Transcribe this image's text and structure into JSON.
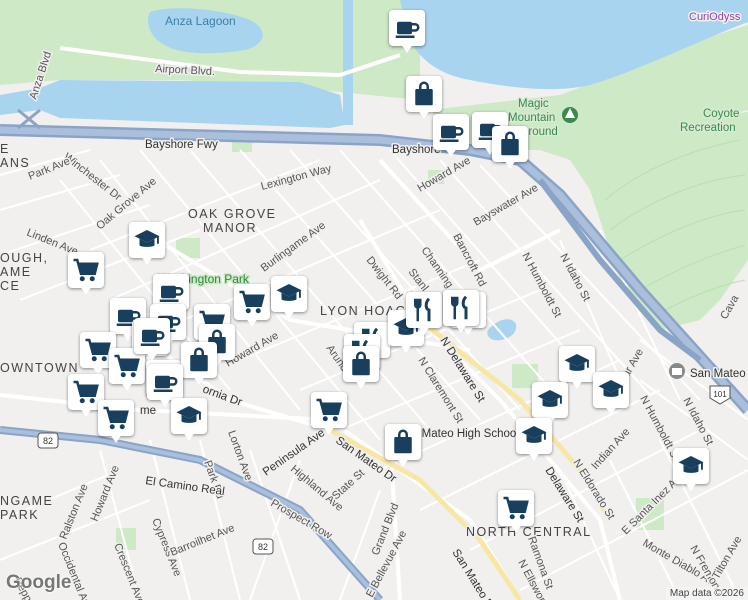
{
  "map": {
    "labels": {
      "anza_lagoon": "Anza Lagoon",
      "airport_blvd": "Airport Blvd.",
      "anza_blvd": "Anza Blvd",
      "bayshore_fwy_1": "Bayshore Fwy",
      "bayshore_fwy_2": "Bayshore",
      "magic_mountain": "Magic Mountain Playground",
      "magic_mountain_l1": "Magic",
      "magic_mountain_l2": "Mountain",
      "magic_mountain_l3": "ground",
      "coyote_point": "Coyote Recreation",
      "coyote_l1": "Coyote",
      "coyote_l2": "Recreation",
      "curiodyssey": "CuriOdyss",
      "oak_grove_manor_1": "OAK GROVE",
      "oak_grove_manor_2": "MANOR",
      "lyon_hoag": "LYON HOAG",
      "washington_park": "Washington Park",
      "downtown": "OWNTOWN",
      "north_central": "NORTH CENTRAL",
      "ngame_park_1": "NGAME",
      "ngame_park_2": "PARK",
      "ough_ame": "OUGH,",
      "ame": "AME",
      "ce": "CE",
      "ans": "ANS",
      "e_top": "E",
      "san_mateo_high": "San Mateo High School",
      "san_mateo_hq": "San Mateo",
      "winchester_dr": "Winchester Dr",
      "park_ave": "Park Ave",
      "oak_grove_ave": "Oak Grove Ave",
      "linden_ave": "Linden Ave",
      "lexington_way": "Lexington Way",
      "burlingame_ave": "Burlingame Ave",
      "howard_ave_top": "Howard Ave",
      "howard_ave_mid": "Howard Ave",
      "howard_ave_low": "Howard Ave",
      "bayswater_ave": "Bayswater Ave",
      "dwight_rd": "Dwight Rd",
      "stanley": "Stanl",
      "channing": "Channing",
      "bancroft_rd": "Bancroft Rd",
      "n_idaho_st": "N Idaho St",
      "n_humboldt_st": "N Humboldt St",
      "n_delaware_st": "N Delaware St",
      "n_delaware_st_2": "Delaware St",
      "n_claremont_st": "N Claremont St",
      "arundel": "Arund",
      "california_dr": "ornia Dr",
      "peninsula_ave": "Peninsula Ave",
      "san_mateo_dr": "San Mateo Dr",
      "san_mateo_dr_2": "San Mateo D",
      "lorton_ave": "Lorton Ave",
      "park_rd": "Park Rd",
      "highland_ave": "Highland Ave",
      "state_st": "State St",
      "prospect_row": "Prospect Row",
      "el_camino_real": "El Camino Real",
      "ralston_ave": "Ralston Ave",
      "howard_ave_sw": "Howard Ave",
      "occidental_ave": "Occidental Ave",
      "crescent_ave": "Crescent Ave",
      "cypress_ave": "Cypress Ave",
      "barroilhet_ave": "Barroilhet Ave",
      "grand_blvd": "Grand Blvd",
      "e_bellevue_ave": "E Bellevue Ave",
      "ramona_st": "Ramona St",
      "n_ellsworth": "N Ellswort",
      "n_eldorado_st": "N Eldorado St",
      "indian_ave": "Indian Ave",
      "e_santa_inez_ave": "E Santa Inez Ave",
      "monte_diablo_ave": "Monte Diablo Ave",
      "n_fremont": "N Fremon",
      "tilton_ave": "Tilton Ave",
      "cava": "Cava",
      "n_idaho_st_2": "N Idaho St",
      "n_humboldt_st_2": "N Humboldt St",
      "poplar_ave": "ar Ave",
      "peppe": "Peppe",
      "route_82_a": "82",
      "route_82_b": "82",
      "route_101": "101",
      "me_label": "me"
    },
    "attribution": "Map data ©2026",
    "google_logo": "Google",
    "colors": {
      "background": "#f1f0ee",
      "water": "#a8d4f0",
      "park": "#cde9c6",
      "highway": "#8aa4c8",
      "marker_icon": "#18405e"
    }
  },
  "markers": [
    {
      "type": "coffee-icon"
    },
    {
      "type": "shopping-bag-icon"
    },
    {
      "type": "coffee-icon"
    },
    {
      "type": "coffee-icon"
    },
    {
      "type": "shopping-bag-icon"
    },
    {
      "type": "school-icon"
    },
    {
      "type": "grocery-cart-icon"
    },
    {
      "type": "coffee-icon"
    },
    {
      "type": "grocery-cart-icon"
    },
    {
      "type": "school-icon"
    },
    {
      "type": "coffee-icon"
    },
    {
      "type": "coffee-icon"
    },
    {
      "type": "grocery-cart-icon"
    },
    {
      "type": "coffee-icon"
    },
    {
      "type": "shopping-bag-icon"
    },
    {
      "type": "grocery-cart-icon"
    },
    {
      "type": "grocery-cart-icon"
    },
    {
      "type": "coffee-icon"
    },
    {
      "type": "coffee-icon"
    },
    {
      "type": "shopping-bag-icon"
    },
    {
      "type": "grocery-cart-icon"
    },
    {
      "type": "grocery-cart-icon"
    },
    {
      "type": "coffee-icon"
    },
    {
      "type": "school-icon"
    },
    {
      "type": "grocery-cart-icon"
    },
    {
      "type": "shopping-bag-icon"
    },
    {
      "type": "restaurant-icon"
    },
    {
      "type": "restaurant-icon"
    },
    {
      "type": "school-icon"
    },
    {
      "type": "restaurant-icon"
    },
    {
      "type": "restaurant-icon"
    },
    {
      "type": "restaurant-icon"
    },
    {
      "type": "shopping-bag-icon"
    },
    {
      "type": "school-icon"
    },
    {
      "type": "school-icon"
    },
    {
      "type": "school-icon"
    },
    {
      "type": "school-icon"
    },
    {
      "type": "school-icon"
    },
    {
      "type": "grocery-cart-icon"
    }
  ]
}
